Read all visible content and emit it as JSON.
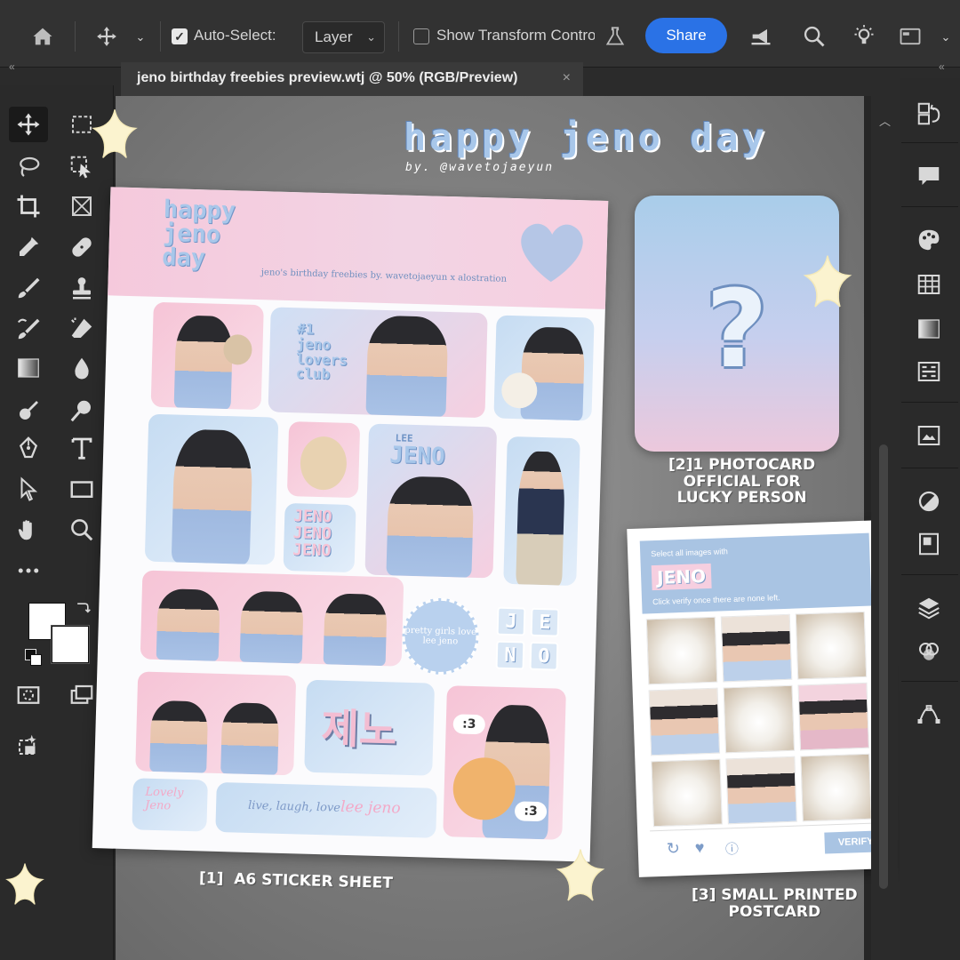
{
  "toolbar": {
    "auto_select_label": "Auto-Select:",
    "layer_select": "Layer",
    "show_transform_label": "Show Transform Contro",
    "share_label": "Share"
  },
  "document_tab": {
    "title": "jeno birthday freebies preview.wtj @ 50% (RGB/Preview)",
    "close": "×"
  },
  "collapse": {
    "left": "«",
    "right": "«"
  },
  "canvas": {
    "title": "happy jeno day",
    "byline": "by. @wavetojaeyun",
    "sheet": {
      "title": "happy\njeno\nday",
      "subtitle": "jeno's birthday freebies by. wavetojaeyun x alostration",
      "lovers_club": "#1\njeno\nlovers\nclub",
      "lee": "LEE",
      "jeno_big": "JENO",
      "jeno_stack": "JENO\nJENO\nJENO",
      "badge": "pretty girls love\nlee jeno",
      "letters": [
        "J",
        "E",
        "N",
        "O"
      ],
      "korean": "제노",
      "bubble1": ":3",
      "bubble2": ":3",
      "lovely": "Lovely\nJeno",
      "live_laugh": "live, laugh, love",
      "live_laugh_name": "lee jeno"
    },
    "photocard": {
      "symbol": "?"
    },
    "postcard": {
      "instruction": "Select all images with",
      "keyword": "JENO",
      "hint": "Click verify once there are none left.",
      "verify_label": "VERIFY"
    },
    "captions": {
      "sticker_sheet": "[1]  A6 STICKER SHEET",
      "photocard": "[2]1 PHOTOCARD\nOFFICIAL FOR\nLUCKY PERSON",
      "postcard": "[3] SMALL PRINTED\nPOSTCARD"
    }
  },
  "colors": {
    "accent_blue": "#2a72e6",
    "pastel_blue": "#a8c7ea",
    "pastel_pink": "#f6c4d6",
    "star_yellow": "#fbf3cf"
  }
}
